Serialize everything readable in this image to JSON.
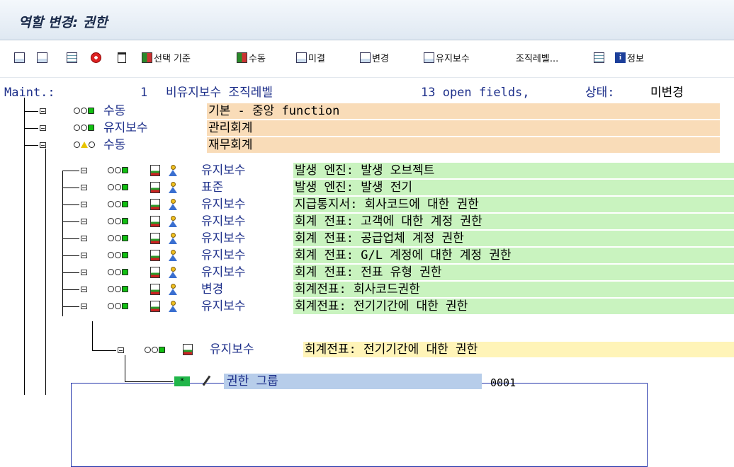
{
  "title": "역할 변경: 권한",
  "toolbar": {
    "items": [
      {
        "name": "expand-icon",
        "label": ""
      },
      {
        "name": "collapse-icon",
        "label": ""
      },
      {
        "name": "grid-icon",
        "label": ""
      },
      {
        "name": "deactivate-icon",
        "label": ""
      },
      {
        "name": "trash-icon",
        "label": ""
      },
      {
        "name": "select-criteria-button",
        "label": "선택 기준"
      },
      {
        "name": "manual-button",
        "label": "수동"
      },
      {
        "name": "open-button",
        "label": "미결"
      },
      {
        "name": "changed-button",
        "label": "변경"
      },
      {
        "name": "maintained-button",
        "label": "유지보수"
      },
      {
        "name": "org-levels-button",
        "label": "조직레벨..."
      },
      {
        "name": "info-button",
        "label": "정보"
      }
    ]
  },
  "header": {
    "maint_label": "Maint.:",
    "count": "1",
    "unmaintained": "비유지보수 조직레벨",
    "open_fields": "13  open fields,",
    "status_label": "상태:",
    "status_value": "미변경"
  },
  "level1": [
    {
      "status": "수동",
      "text": "기본 - 중앙 function"
    },
    {
      "status": "유지보수",
      "text": "관리회계"
    },
    {
      "status": "수동",
      "text": "재무회계"
    }
  ],
  "level2": [
    {
      "status": "유지보수",
      "text": "발생 엔진: 발생 오브젝트"
    },
    {
      "status": "표준",
      "text": "발생 엔진: 발생 전기"
    },
    {
      "status": "유지보수",
      "text": "지급통지서: 회사코드에 대한 권한"
    },
    {
      "status": "유지보수",
      "text": "회계 전표: 고객에 대한 계정 권한"
    },
    {
      "status": "유지보수",
      "text": "회계 전표: 공급업체 계정 권한"
    },
    {
      "status": "유지보수",
      "text": "회계 전표: G/L 계정에 대한 계정 권한"
    },
    {
      "status": "유지보수",
      "text": "회계 전표: 전표 유형 권한"
    },
    {
      "status": "변경",
      "text": "회계전표: 회사코드권한"
    },
    {
      "status": "유지보수",
      "text": "회계전표: 전기기간에 대한 권한"
    }
  ],
  "level3": {
    "status": "유지보수",
    "text": "회계전표: 전기기간에 대한 권한"
  },
  "field": {
    "name": "권한 그룹",
    "value": "0001",
    "star": "*"
  }
}
